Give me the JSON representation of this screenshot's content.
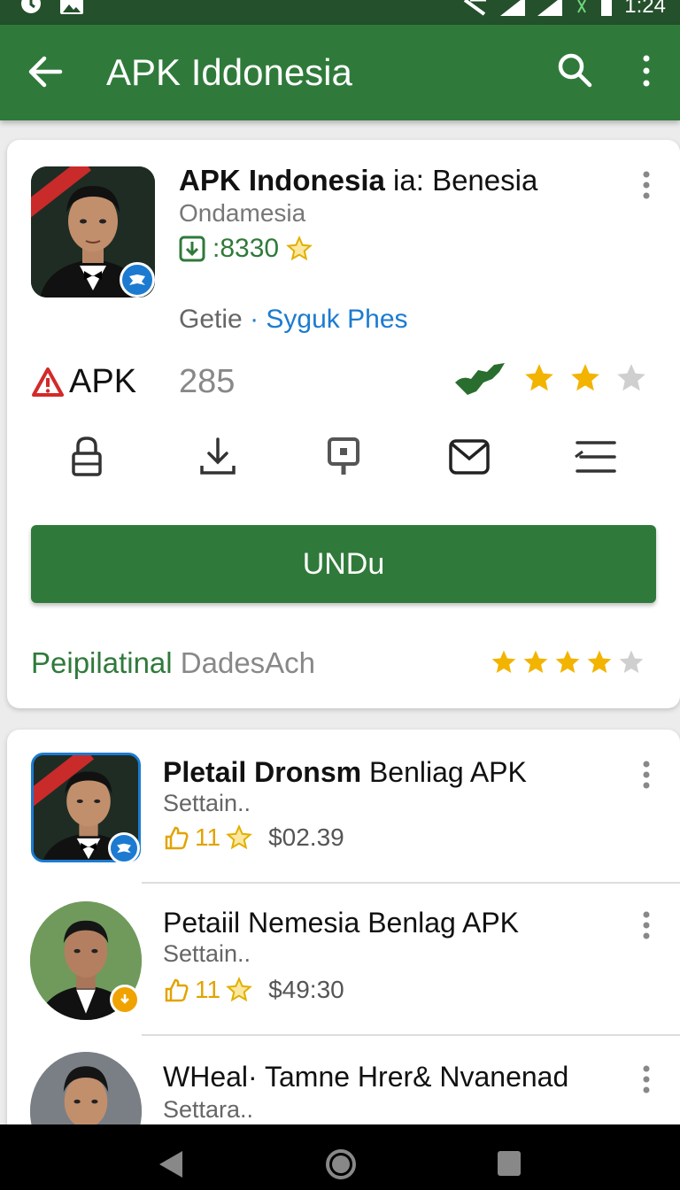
{
  "status_bar": {
    "time": "1:24"
  },
  "app_bar": {
    "title": "APK Iddonesia"
  },
  "featured": {
    "title_bold": "APK Indonesia",
    "title_rest": "ia: Benesia",
    "developer": "Ondamesia",
    "downloads": ":8330",
    "category": "Getie",
    "separator": "·",
    "publisher_link": "Syguk Phes",
    "apk_label": "APK",
    "count": "285",
    "rating_stars": 2.5,
    "install_label": "UNDu",
    "footer_green": "Peipilatinal",
    "footer_gray": "DadesAch",
    "footer_stars": 4,
    "accent_color": "#2f7a3a",
    "star_color": "#f2b400"
  },
  "list": [
    {
      "title_bold": "Pletail Dronsm",
      "title_rest": "Benliag APK",
      "subtitle": "Settain..",
      "rating": "11",
      "price": "$02.39"
    },
    {
      "title": "Petaiil Nemesia Benlag APK",
      "subtitle": "Settain..",
      "rating": "11",
      "price": "$49:30"
    },
    {
      "title": "WHeal· Tamne Hrer& Nvanenad",
      "subtitle": "Settara.."
    }
  ]
}
